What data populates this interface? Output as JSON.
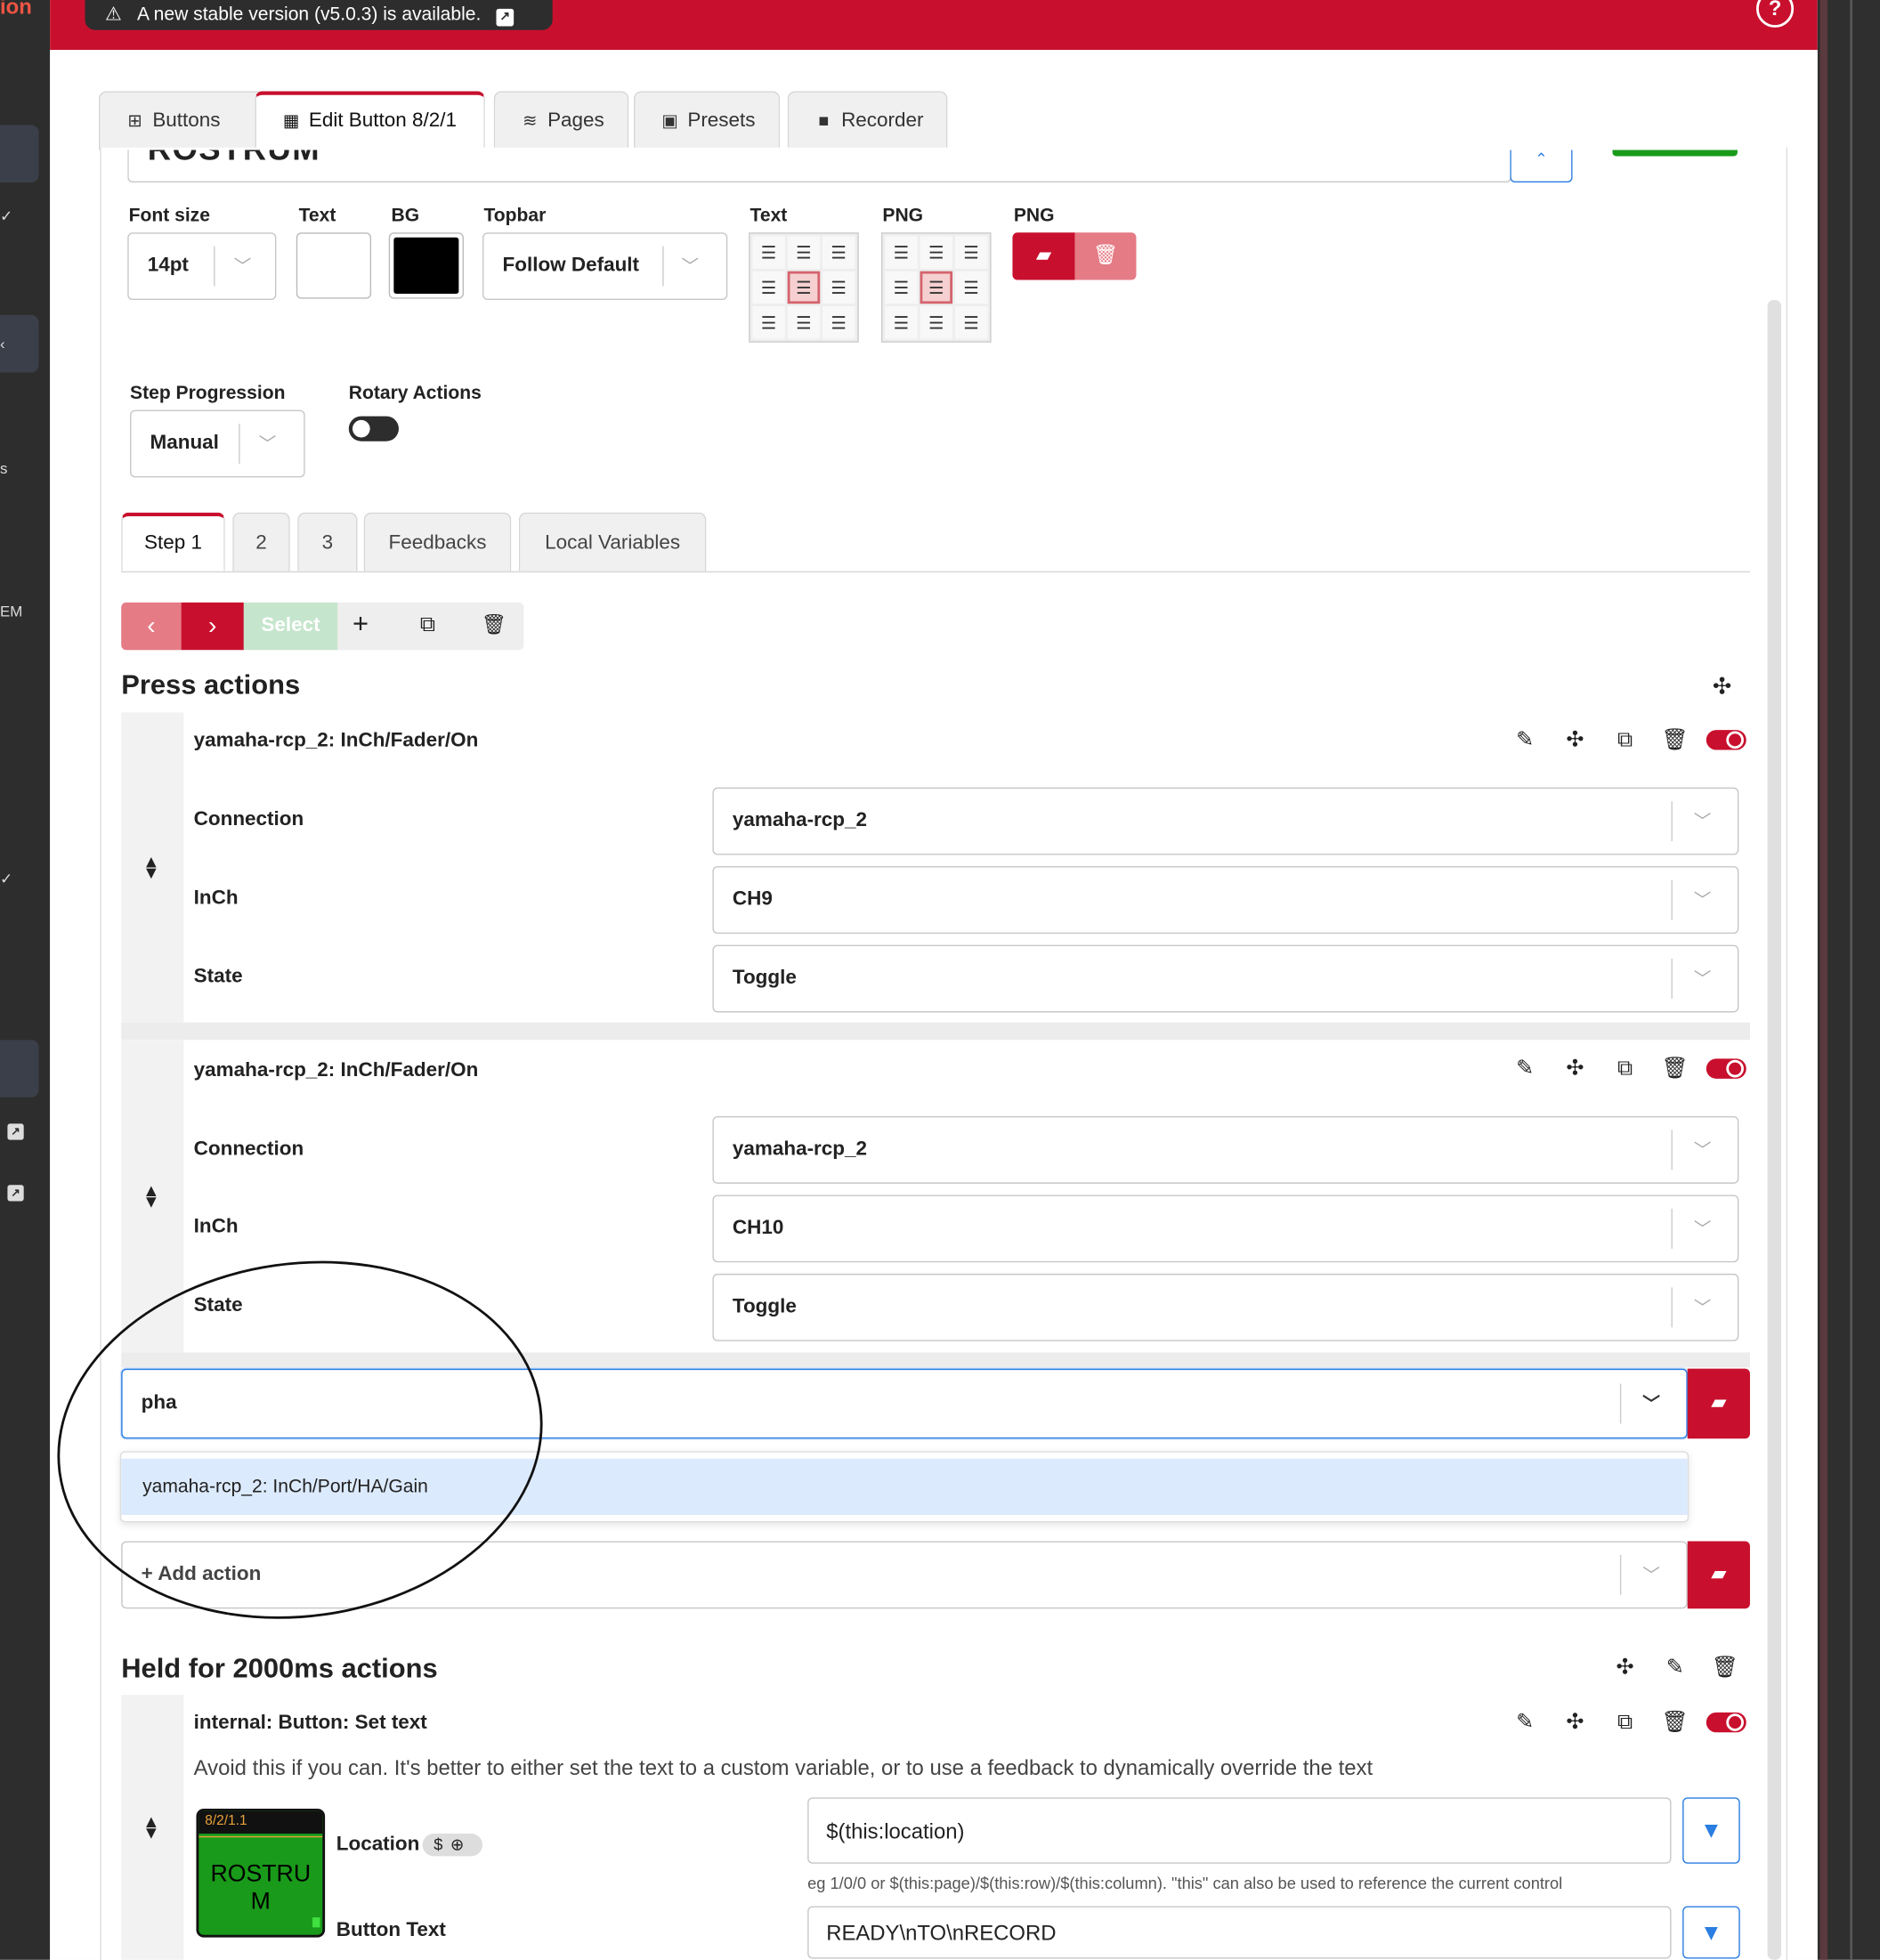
{
  "app": {
    "notice": "A new stable version (v5.0.3) is available.",
    "help": "?"
  },
  "sidebar": {
    "partial_labels": [
      "ion",
      "s",
      "EM"
    ]
  },
  "tabs": [
    {
      "icon": "grid-icon",
      "label": "Buttons"
    },
    {
      "icon": "calculator-icon",
      "label": "Edit Button 8/2/1"
    },
    {
      "icon": "layers-icon",
      "label": "Pages"
    },
    {
      "icon": "gift-icon",
      "label": "Presets"
    },
    {
      "icon": "video-icon",
      "label": "Recorder"
    }
  ],
  "button_name": "ROSTRUM",
  "style": {
    "font_size_label": "Font size",
    "font_size": "14pt",
    "text_color_label": "Text",
    "text_color": "#ffffff",
    "bg_label": "BG",
    "bg_color": "#000000",
    "topbar_label": "Topbar",
    "topbar": "Follow Default",
    "text_align_label": "Text",
    "png_align_label": "PNG",
    "png_label": "PNG"
  },
  "step_progression": {
    "label": "Step Progression",
    "value": "Manual"
  },
  "rotary_actions": {
    "label": "Rotary Actions",
    "enabled": false
  },
  "step_tabs": [
    "Step 1",
    "2",
    "3",
    "Feedbacks",
    "Local Variables"
  ],
  "step_toolbar": {
    "select_label": "Select"
  },
  "press_actions": {
    "title": "Press actions",
    "actions": [
      {
        "name": "yamaha-rcp_2: InCh/Fader/On",
        "fields": [
          {
            "label": "Connection",
            "value": "yamaha-rcp_2"
          },
          {
            "label": "InCh",
            "value": "CH9"
          },
          {
            "label": "State",
            "value": "Toggle"
          }
        ]
      },
      {
        "name": "yamaha-rcp_2: InCh/Fader/On",
        "fields": [
          {
            "label": "Connection",
            "value": "yamaha-rcp_2"
          },
          {
            "label": "InCh",
            "value": "CH10"
          },
          {
            "label": "State",
            "value": "Toggle"
          }
        ]
      }
    ],
    "search_value": "pha",
    "suggestion": "yamaha-rcp_2: InCh/Port/HA/Gain",
    "add_action": "+ Add action"
  },
  "held_actions": {
    "title": "Held for 2000ms actions",
    "action": {
      "name": "internal: Button: Set text",
      "warning": "Avoid this if you can. It's better to either set the text to a custom variable, or to use a feedback to dynamically override the text",
      "preview": {
        "location": "8/2/1.1",
        "line1": "ROSTRU",
        "line2": "M"
      },
      "location_label": "Location",
      "location_badge": "$",
      "location_value": "$(this:location)",
      "location_hint": "eg 1/0/0 or $(this:page)/$(this:row)/$(this:column). \"this\" can also be used to reference the current control",
      "text_label": "Button Text",
      "text_value": "READY\\nTO\\nRECORD"
    }
  },
  "colors": {
    "accent": "#c8102e",
    "focus": "#2a7de1",
    "preview_green": "#1a9a1a"
  }
}
